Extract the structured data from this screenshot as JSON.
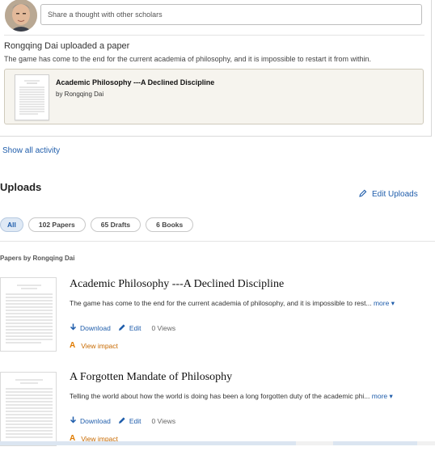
{
  "share": {
    "placeholder": "Share a thought with other scholars"
  },
  "activity": {
    "title": "Rongqing Dai uploaded a paper",
    "description": "The game has come to the end for the current academia of philosophy, and it is impossible to restart it from within.",
    "paper": {
      "title": "Academic Philosophy ---A Declined Discipline",
      "author": "by Rongqing Dai"
    }
  },
  "show_all_activity": "Show all activity",
  "uploads": {
    "title": "Uploads",
    "edit_label": "Edit Uploads",
    "tabs": [
      {
        "label": "All",
        "active": true
      },
      {
        "label": "102 Papers"
      },
      {
        "label": "65 Drafts"
      },
      {
        "label": "6 Books"
      }
    ],
    "papers_by": "Papers by Rongqing Dai",
    "papers": [
      {
        "title": "Academic Philosophy ---A Declined Discipline",
        "description": "The game has come to the end for the current academia of philosophy, and it is impossible to rest...",
        "more": "more",
        "download": "Download",
        "edit": "Edit",
        "views": "0 Views",
        "impact": "View impact"
      },
      {
        "title": "A Forgotten Mandate of Philosophy",
        "description": "Telling the world about how the world is doing has been a long forgotten duty of the academic phi...",
        "more": "more",
        "download": "Download",
        "edit": "Edit",
        "views": "0 Views",
        "impact": "View impact"
      }
    ]
  },
  "colors": {
    "link": "#1f5dab",
    "impact": "#e07b00",
    "paper_box_bg": "#f6f4ee"
  }
}
